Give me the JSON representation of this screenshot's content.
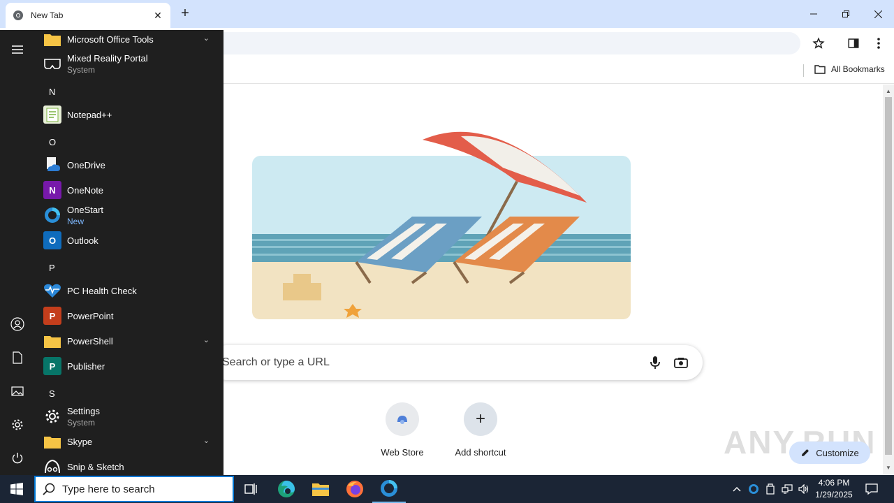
{
  "browser": {
    "tab": {
      "title": "New Tab"
    },
    "bookmarks": {
      "all_label": "All Bookmarks"
    }
  },
  "page": {
    "search_placeholder": "Search or type a URL",
    "shortcuts": [
      {
        "label": "Web Store",
        "icon": "web-store-icon"
      },
      {
        "label": "Add shortcut",
        "icon": "plus-icon"
      }
    ],
    "customize_label": "Customize",
    "watermark": "ANY.RUN"
  },
  "startmenu": {
    "apps": [
      {
        "name": "Microsoft Office Tools",
        "icon": "folder-icon",
        "expandable": true
      },
      {
        "name": "Mixed Reality Portal",
        "sub": "System",
        "icon": "mixed-reality-icon"
      },
      {
        "letter": "N"
      },
      {
        "name": "Notepad++",
        "icon": "notepad-plus-plus-icon"
      },
      {
        "letter": "O"
      },
      {
        "name": "OneDrive",
        "icon": "onedrive-icon"
      },
      {
        "name": "OneNote",
        "icon": "onenote-icon"
      },
      {
        "name": "OneStart",
        "sub": "New",
        "icon": "onestart-icon"
      },
      {
        "name": "Outlook",
        "icon": "outlook-icon"
      },
      {
        "letter": "P"
      },
      {
        "name": "PC Health Check",
        "icon": "pc-health-icon"
      },
      {
        "name": "PowerPoint",
        "icon": "powerpoint-icon"
      },
      {
        "name": "PowerShell",
        "icon": "folder-icon",
        "expandable": true
      },
      {
        "name": "Publisher",
        "icon": "publisher-icon"
      },
      {
        "letter": "S"
      },
      {
        "name": "Settings",
        "sub": "System",
        "icon": "settings-icon"
      },
      {
        "name": "Skype",
        "icon": "folder-icon",
        "expandable": true
      },
      {
        "name": "Snip & Sketch",
        "icon": "snip-sketch-icon"
      }
    ]
  },
  "taskbar": {
    "search_placeholder": "Type here to search",
    "time": "4:06 PM",
    "date": "1/29/2025"
  },
  "colors": {
    "tabbar": "#d3e3fd",
    "startmenu": "#1f1f1f",
    "taskbar": "#1b2535",
    "accent": "#0078d4"
  }
}
